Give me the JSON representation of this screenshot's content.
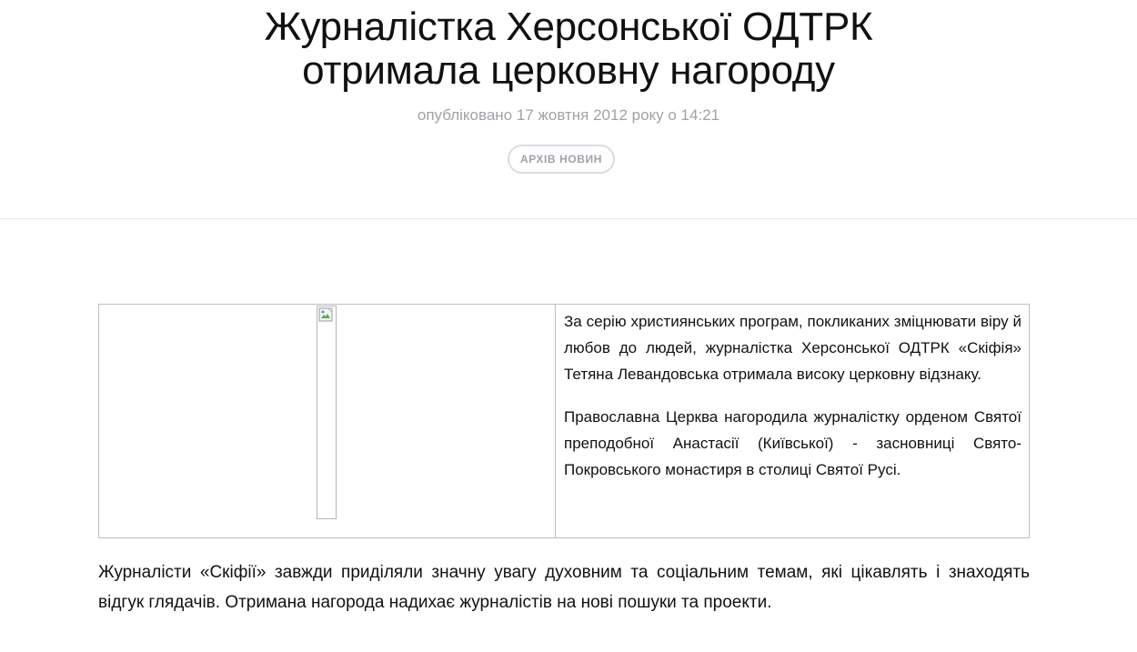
{
  "article": {
    "title_line1": "Журналістка Херсонської ОДТРК",
    "title_line2": "отримала церковну нагороду",
    "published": "опубліковано 17 жовтня 2012 року о 14:21",
    "tag": "АРХІВ НОВИН",
    "paragraph1": "За серію християнських програм, покликаних зміцнювати віру й любов до людей, журналістка Херсонської ОДТРК «Скіфія» Тетяна Левандовська отримала високу церковну відзнаку.",
    "paragraph2": "Православна Церква нагородила журналістку орденом Святої преподобної Анастасії (Київської) - засновниці Свято-Покровського монастиря в столиці Святої Русі.",
    "paragraph3": "Журналісти «Скіфії» завжди приділяли значну увагу духовним та соціальним темам, які цікавлять і знаходять відгук глядачів. Отримана нагорода надихає журналістів на нові пошуки та проекти."
  },
  "icons": {
    "image": "broken-image-icon"
  },
  "colors": {
    "text": "#111111",
    "muted": "#9ea3a8",
    "border": "#bdbdbd",
    "divider": "#e6e8eb"
  }
}
